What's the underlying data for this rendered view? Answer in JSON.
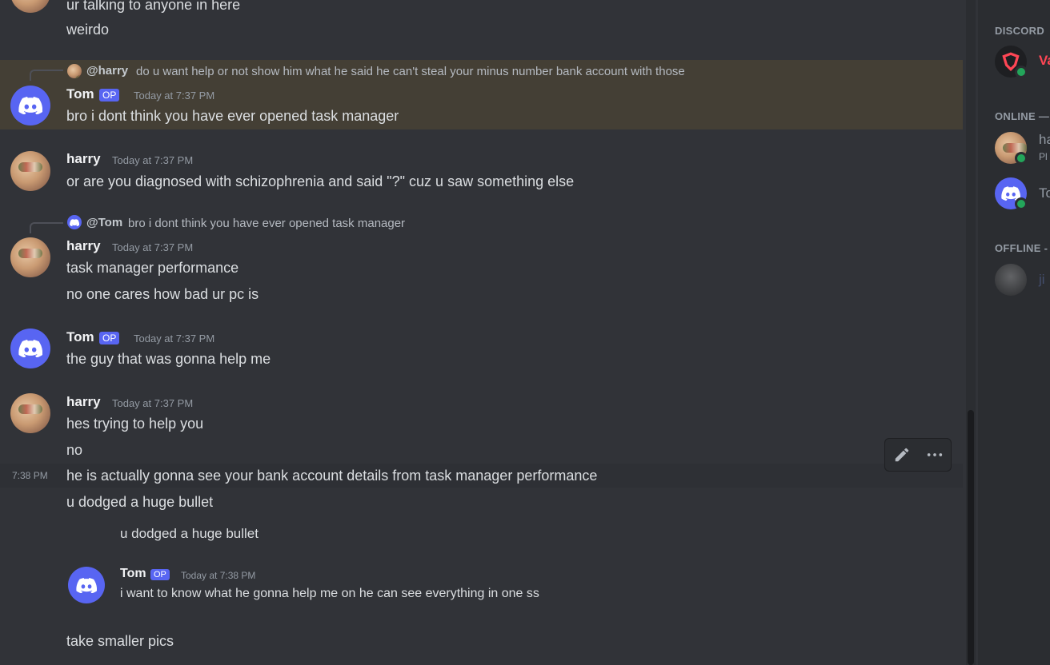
{
  "chat": {
    "top_messages": [
      "ur talking to anyone in here",
      "weirdo"
    ],
    "hl_reply": {
      "name": "@harry",
      "text": "do u want help or not show him what he said he can't steal your minus number bank account with those"
    },
    "tom_msg1": {
      "author": "Tom",
      "badge": "OP",
      "time": "Today at 7:37 PM",
      "text": "bro i dont think you have ever opened task manager"
    },
    "harry_msg1": {
      "author": "harry",
      "time": "Today at 7:37 PM",
      "text": "or are you diagnosed with schizophrenia and said \"?\" cuz u saw something else"
    },
    "reply2": {
      "name": "@Tom",
      "text": "bro i dont think you have ever opened task manager"
    },
    "harry_msg2": {
      "author": "harry",
      "time": "Today at 7:37 PM",
      "lines": [
        "task manager performance",
        "no one cares how bad ur pc is"
      ]
    },
    "tom_msg2": {
      "author": "Tom",
      "badge": "OP",
      "time": "Today at 7:37 PM",
      "text": "the guy that was gonna help me"
    },
    "harry_msg3": {
      "author": "harry",
      "time": "Today at 7:37 PM",
      "lines": [
        "hes trying to help you",
        "no",
        "he is actually gonna see your bank account details from task manager performance",
        "u dodged a huge bullet"
      ],
      "hover_time": "7:38 PM"
    },
    "embed": {
      "quoted": "u dodged a huge bullet",
      "author": "Tom",
      "badge": "OP",
      "time": "Today at 7:38 PM",
      "text": "i want to know what he gonna help me on he can see everything in one ss"
    },
    "last_message": "take smaller pics"
  },
  "toolbar": {
    "edit_icon": "pencil-icon",
    "more_icon": "more-dots-icon"
  },
  "members": {
    "section_discord": "DISCORD",
    "bot_name": "Va",
    "section_online": "ONLINE —",
    "online": [
      {
        "name": "ha",
        "sub": "Pl"
      },
      {
        "name": "To"
      }
    ],
    "section_offline": "OFFLINE -",
    "offline": [
      {
        "name": "ji"
      }
    ]
  },
  "colors": {
    "background": "#313338",
    "highlight": "#443f35",
    "blurple": "#5865f2",
    "online": "#23a55a"
  }
}
